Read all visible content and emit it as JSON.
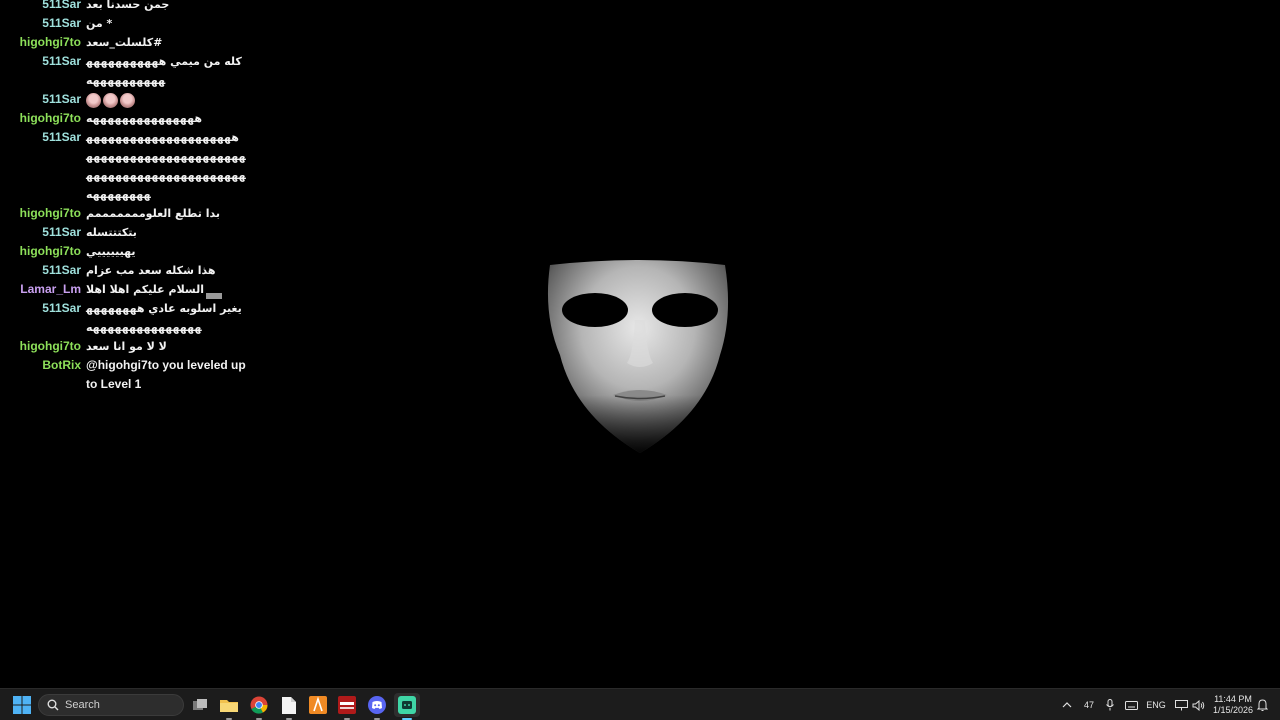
{
  "chat": {
    "messages": [
      {
        "user": "511Sar",
        "color": "#9fe0dc",
        "text": "جمن حسدنا بعد"
      },
      {
        "user": "511Sar",
        "color": "#9fe0dc",
        "text": "* من"
      },
      {
        "user": "higohgi7to",
        "color": "#8de05a",
        "text": "#كلسلت_سعد"
      },
      {
        "user": "511Sar",
        "color": "#9fe0dc",
        "text": "كله من ميمي هههههههههههههههههههههه"
      },
      {
        "user": "511Sar",
        "color": "#9fe0dc",
        "text": "",
        "emoji": 3
      },
      {
        "user": "higohgi7to",
        "color": "#8de05a",
        "text": "هههههههههههههههه"
      },
      {
        "user": "511Sar",
        "color": "#9fe0dc",
        "text": "هههههههههههههههههههههههههههههههههههههههههههههههههههههههههههههههههههههههههه"
      },
      {
        "user": "higohgi7to",
        "color": "#8de05a",
        "text": "بدا تطلع العلومممممممم"
      },
      {
        "user": "511Sar",
        "color": "#9fe0dc",
        "text": "بتكتتتسله"
      },
      {
        "user": "higohgi7to",
        "color": "#8de05a",
        "text": "يهييييييي"
      },
      {
        "user": "511Sar",
        "color": "#9fe0dc",
        "text": "هذا شكله سعد مب عزام"
      },
      {
        "user": "Lamar_Lm",
        "color": "#c9a0f0",
        "text": "السلام عليكم اهلا اهلا",
        "badge": true
      },
      {
        "user": "511Sar",
        "color": "#9fe0dc",
        "text": "يغير اسلوبه عادي هههههههههههههههههههههههه"
      },
      {
        "user": "higohgi7to",
        "color": "#8de05a",
        "text": "لا لا مو انا سعد"
      },
      {
        "user": "BotRix",
        "color": "#8de05a",
        "text": "@higohgi7to you leveled up to Level 1",
        "en": true
      }
    ]
  },
  "taskbar": {
    "search_placeholder": "Search",
    "apps": [
      "task-view",
      "file-explorer",
      "chrome",
      "notepad",
      "app-orange",
      "voice-app",
      "discord",
      "game-app"
    ],
    "tray": {
      "badge_count": "47",
      "language": "ENG"
    },
    "clock": {
      "time": "11:44 PM",
      "date": "1/15/2026"
    }
  }
}
